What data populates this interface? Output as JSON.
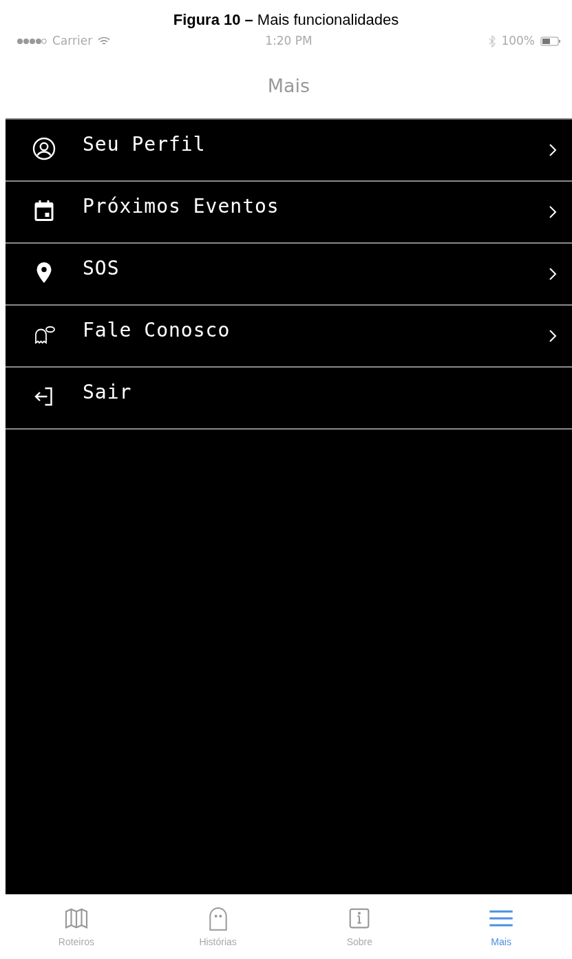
{
  "caption": {
    "label": "Figura 10 –",
    "title": "Mais funcionalidades"
  },
  "status_bar": {
    "carrier": "Carrier",
    "time": "1:20 PM",
    "battery": "100%"
  },
  "nav_bar": {
    "title": "Mais"
  },
  "menu": [
    {
      "kind": "profile",
      "label": "Seu Perfil",
      "chevron": true
    },
    {
      "kind": "calendar",
      "label": "Próximos Eventos",
      "chevron": true
    },
    {
      "kind": "pin",
      "label": "SOS",
      "chevron": true
    },
    {
      "kind": "ghost-chat",
      "label": "Fale Conosco",
      "chevron": true
    },
    {
      "kind": "logout",
      "label": "Sair",
      "chevron": false
    }
  ],
  "tabs": [
    {
      "kind": "map",
      "label": "Roteiros",
      "selected": false
    },
    {
      "kind": "ghost",
      "label": "Histórias",
      "selected": false
    },
    {
      "kind": "info",
      "label": "Sobre",
      "selected": false
    },
    {
      "kind": "menu",
      "label": "Mais",
      "selected": true
    }
  ]
}
